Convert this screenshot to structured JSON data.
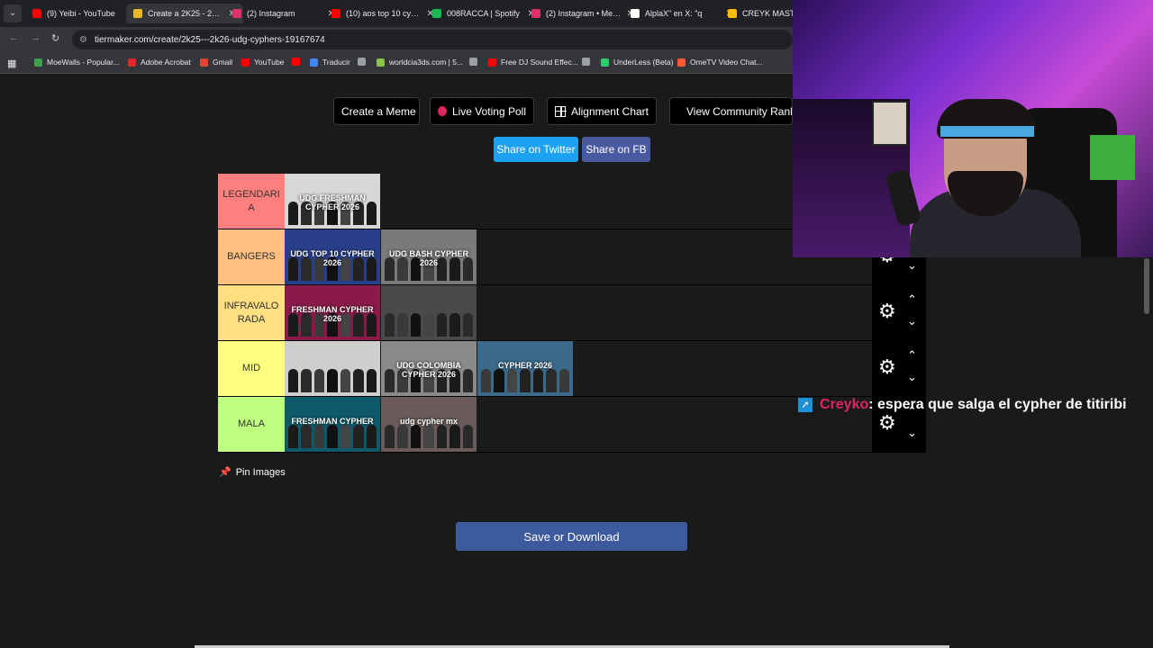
{
  "browser": {
    "tabs": [
      {
        "title": "(9) Yeibi - YouTube",
        "color": "#ff0000",
        "active": false
      },
      {
        "title": "Create a 2K25 - 2K26",
        "color": "#f0b429",
        "active": true
      },
      {
        "title": "(2) Instagram",
        "color": "#e1306c",
        "active": false
      },
      {
        "title": "(10) aos top 10 cypher",
        "color": "#ff0000",
        "active": false
      },
      {
        "title": "008RACCA | Spotify",
        "color": "#1db954",
        "active": false
      },
      {
        "title": "(2) Instagram • Mensajes",
        "color": "#e1306c",
        "active": false
      },
      {
        "title": "AlplaX\" en X: \"q",
        "color": "#ffffff",
        "active": false
      },
      {
        "title": "CREYK MASTER",
        "color": "#fbbc04",
        "active": false
      }
    ],
    "url": "tiermaker.com/create/2k25---2k26-udg-cyphers-19167674",
    "bookmarks": [
      {
        "label": "MoeWalls - Popular...",
        "color": "#3ea04a"
      },
      {
        "label": "Adobe Acrobat",
        "color": "#e5252a"
      },
      {
        "label": "Gmail",
        "color": "#ea4335"
      },
      {
        "label": "YouTube",
        "color": "#ff0000"
      },
      {
        "label": "",
        "color": "#ff0000"
      },
      {
        "label": "Traducir",
        "color": "#4285f4"
      },
      {
        "label": "",
        "color": "#9aa0a6"
      },
      {
        "label": "worldcia3ds.com | 5...",
        "color": "#8bc34a"
      },
      {
        "label": "",
        "color": "#9aa0a6"
      },
      {
        "label": "Free DJ Sound Effec...",
        "color": "#ff0000"
      },
      {
        "label": "",
        "color": "#9aa0a6"
      },
      {
        "label": "UnderLess (Beta)",
        "color": "#2ecc71"
      },
      {
        "label": "OmeTV Video Chat...",
        "color": "#ff5a36"
      }
    ]
  },
  "toolbar": {
    "create_meme": "Create a Meme",
    "live_voting": "Live Voting Poll",
    "alignment_chart": "Alignment Chart",
    "view_community": "View Community Rankings"
  },
  "share": {
    "twitter": "Share on Twitter",
    "facebook": "Share on FB"
  },
  "tiers": [
    {
      "label": "LEGENDARIA",
      "color": "#ff7f7f",
      "items": [
        {
          "caption": "UDG FRESHMAN CYPHER 2026",
          "bg": "#d8d8d8"
        }
      ]
    },
    {
      "label": "BANGERS",
      "color": "#ffbf7f",
      "items": [
        {
          "caption": "UDG TOP 10 CYPHER 2026",
          "bg": "#2a3f8a"
        },
        {
          "caption": "UDG BASH CYPHER 2026",
          "bg": "#7a7a7a"
        }
      ]
    },
    {
      "label": "INFRAVALORADA",
      "color": "#ffdf7f",
      "items": [
        {
          "caption": "FRESHMAN CYPHER 2026",
          "bg": "#8a1a4a"
        },
        {
          "caption": "",
          "bg": "#4a4a4a"
        }
      ]
    },
    {
      "label": "MID",
      "color": "#ffff7f",
      "items": [
        {
          "caption": "",
          "bg": "#cfcfcf"
        },
        {
          "caption": "UDG COLOMBIA CYPHER 2026",
          "bg": "#8a8a8a"
        },
        {
          "caption": "CYPHER 2026",
          "bg": "#3a6a8a"
        }
      ]
    },
    {
      "label": "MALA",
      "color": "#bfff7f",
      "items": [
        {
          "caption": "FRESHMAN CYPHER",
          "bg": "#0f5a6a"
        },
        {
          "caption": "udg cypher mx",
          "bg": "#6a5a5a"
        }
      ]
    }
  ],
  "pin_label": "Pin Images",
  "save_label": "Save or Download",
  "chat": {
    "user": "Creyko",
    "message": ": espera que salga el cypher de titiribi"
  }
}
